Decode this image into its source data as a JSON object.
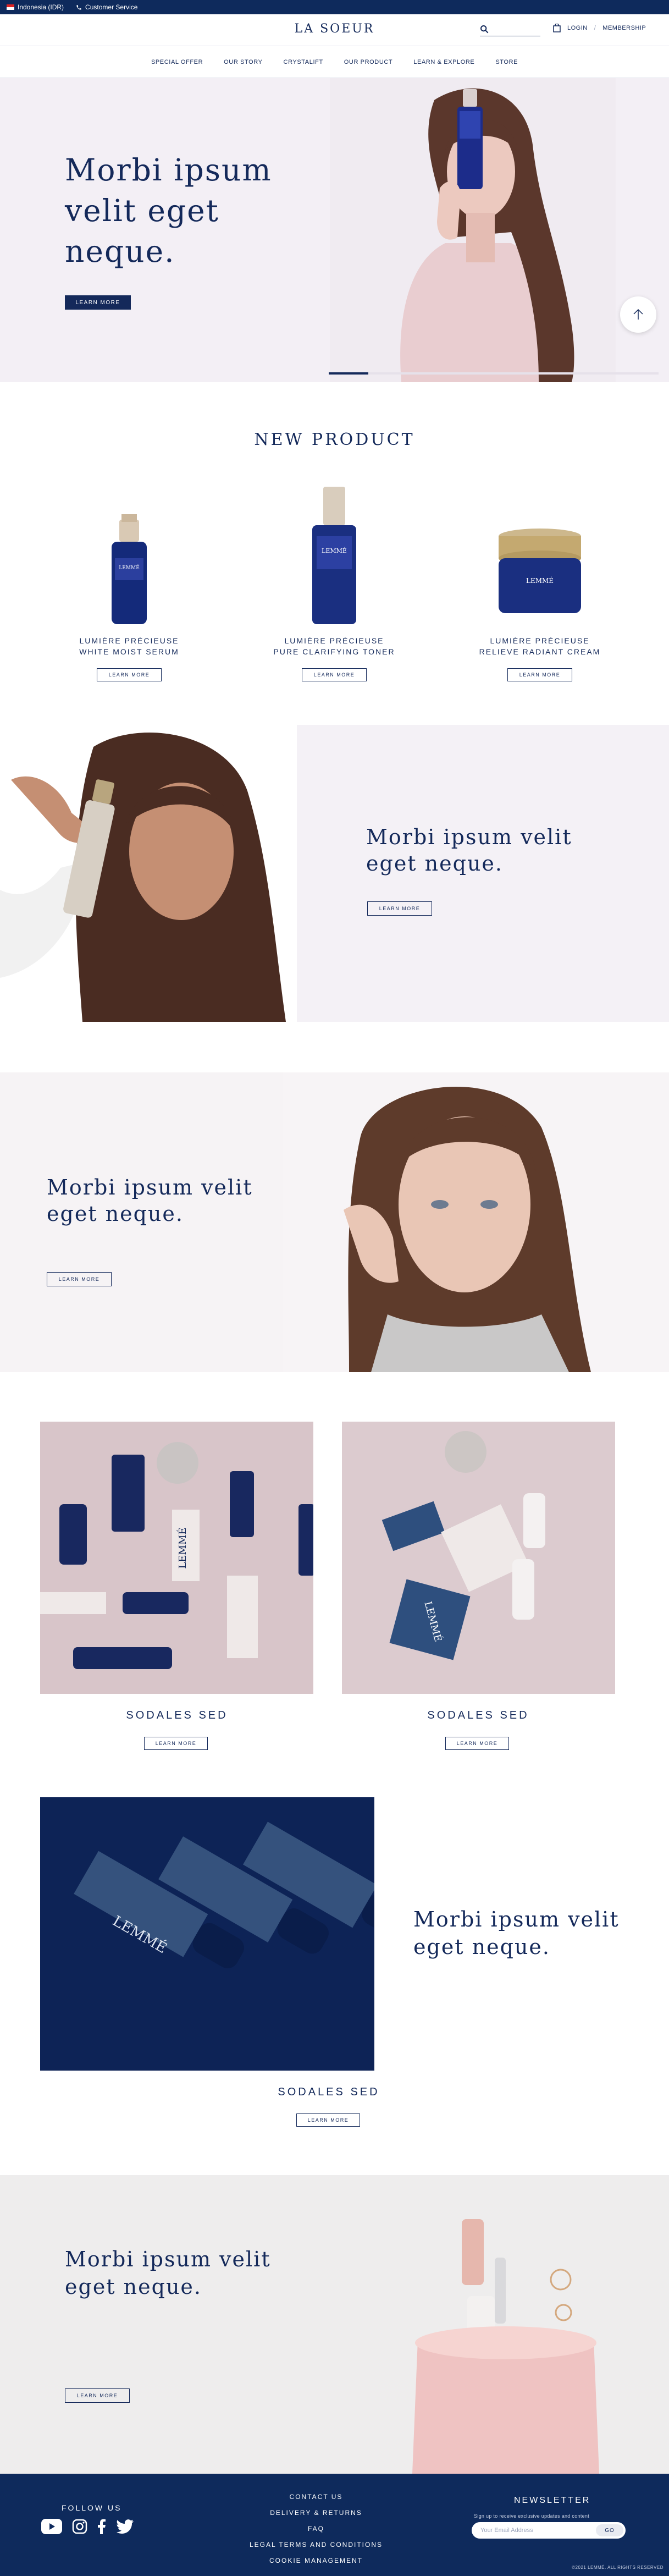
{
  "topbar": {
    "region": "Indonesia (IDR)",
    "customer_service": "Customer Service"
  },
  "header": {
    "logo": "LA SOEUR",
    "search_placeholder": "",
    "login": "LOGIN",
    "separator": "/",
    "membership": "MEMBERSHIP"
  },
  "nav": [
    "SPECIAL OFFER",
    "OUR STORY",
    "CRYSTALIFT",
    "OUR PRODUCT",
    "LEARN & EXPLORE",
    "STORE"
  ],
  "hero": {
    "title": "Morbi ipsum velit eget neque.",
    "button": "LEARN MORE",
    "slide_progress": 0.12
  },
  "new_product": {
    "title": "NEW PRODUCT",
    "products": [
      {
        "line1": "LUMIÈRE PRÉCIEUSE",
        "line2": "WHITE MOIST SERUM",
        "button": "LEARN MORE",
        "brand": "LEMMÉ"
      },
      {
        "line1": "LUMIÈRE PRÉCIEUSE",
        "line2": "PURE CLARIFYING TONER",
        "button": "LEARN MORE",
        "brand": "LEMMÉ"
      },
      {
        "line1": "LUMIÈRE PRÉCIEUSE",
        "line2": "RELIEVE RADIANT CREAM",
        "button": "LEARN MORE",
        "brand": "LEMMÉ"
      }
    ]
  },
  "banner1": {
    "title": "Morbi ipsum velit eget neque.",
    "button": "LEARN MORE"
  },
  "banner2": {
    "title": "Morbi ipsum velit eget neque.",
    "button": "LEARN MORE"
  },
  "tiles": [
    {
      "label": "SODALES SED",
      "button": "LEARN MORE",
      "brand": "LEMMÉ"
    },
    {
      "label": "SODALES SED",
      "button": "LEARN MORE",
      "brand": "LEMMÉ"
    }
  ],
  "feature": {
    "title": "Morbi ipsum velit eget neque.",
    "label": "SODALES SED",
    "button": "LEARN MORE",
    "brand": "LEMMÉ"
  },
  "banner3": {
    "title": "Morbi ipsum velit eget neque.",
    "button": "LEARN MORE"
  },
  "footer": {
    "follow": "FOLLOW US",
    "links": [
      "CONTACT US",
      "DELIVERY & RETURNS",
      "FAQ",
      "LEGAL TERMS AND CONDITIONS",
      "COOKIE MANAGEMENT"
    ],
    "newsletter_title": "NEWSLETTER",
    "newsletter_sub": "Sign up to receive exclusive updates and content",
    "email_placeholder": "Your Email Address",
    "go": "GO",
    "copyright": "©2021 LEMMÉ. ALL RIGHTS RESERVED"
  },
  "colors": {
    "navy": "#14295a",
    "footer": "#0e2a5c",
    "blush": "#f3eff5",
    "tile": "#d9c7cb"
  }
}
